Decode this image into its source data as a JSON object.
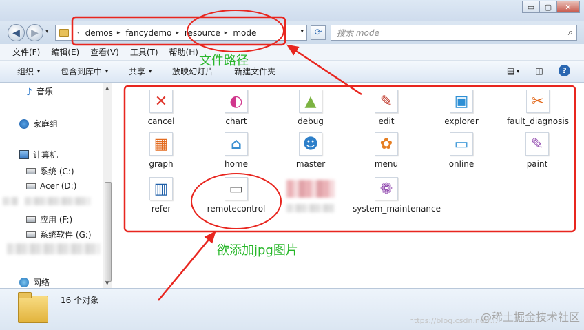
{
  "window": {
    "controls": {
      "minimize": "▭",
      "maximize": "▢",
      "close": "✕"
    }
  },
  "nav": {
    "back_icon": "◀",
    "forward_icon": "▶",
    "history_icon": "▾",
    "breadcrumbs": [
      "demos",
      "fancydemo",
      "resource",
      "mode"
    ],
    "lead_sep": "‹",
    "sep": "▸",
    "dropdown_icon": "▾",
    "refresh_icon": "⟳",
    "search_placeholder": "搜索 mode",
    "search_icon": "⌕"
  },
  "menubar": {
    "items": [
      "文件(F)",
      "编辑(E)",
      "查看(V)",
      "工具(T)",
      "帮助(H)"
    ]
  },
  "commands": {
    "items": [
      {
        "label": "组织",
        "arrow": "▾"
      },
      {
        "label": "包含到库中",
        "arrow": "▾"
      },
      {
        "label": "共享",
        "arrow": "▾"
      },
      {
        "label": "放映幻灯片",
        "arrow": ""
      },
      {
        "label": "新建文件夹",
        "arrow": ""
      }
    ],
    "view_icon": "▤",
    "view_arrow": "▾",
    "preview_icon": "◫",
    "help_icon": "?"
  },
  "navpane": {
    "music": "音乐",
    "music_icon": "♪",
    "homegroup": "家庭组",
    "computer": "计算机",
    "drive_c": "系统 (C:)",
    "drive_d": "Acer (D:)",
    "drive_f": "应用 (F:)",
    "drive_g": "系统软件 (G:)",
    "network": "网络",
    "scroll_up": "▲",
    "scroll_down": "▼"
  },
  "files": [
    {
      "name": "cancel",
      "glyph": "✕",
      "color": "#e0362c"
    },
    {
      "name": "chart",
      "glyph": "◐",
      "color": "#d0368c"
    },
    {
      "name": "debug",
      "glyph": "▲",
      "color": "#7cb342"
    },
    {
      "name": "edit",
      "glyph": "✎",
      "color": "#c0392b"
    },
    {
      "name": "explorer",
      "glyph": "▣",
      "color": "#2d8fd5"
    },
    {
      "name": "fault_diagnosis",
      "glyph": "✂",
      "color": "#e36b1f"
    },
    {
      "name": "graph",
      "glyph": "▦",
      "color": "#e36b1f"
    },
    {
      "name": "home",
      "glyph": "⌂",
      "color": "#3b8fd1"
    },
    {
      "name": "master",
      "glyph": "☻",
      "color": "#2d7fc9"
    },
    {
      "name": "menu",
      "glyph": "✿",
      "color": "#e67e22"
    },
    {
      "name": "online",
      "glyph": "▭",
      "color": "#2d8fd5"
    },
    {
      "name": "paint",
      "glyph": "✎",
      "color": "#9b59b6"
    },
    {
      "name": "refer",
      "glyph": "▥",
      "color": "#1f5fa8"
    },
    {
      "name": "remotecontrol",
      "glyph": "▭",
      "color": "#444444"
    },
    {
      "name": "system_maintenance",
      "glyph": "❁",
      "color": "#8e44ad"
    }
  ],
  "details": {
    "count": "16 个对象"
  },
  "annotations": {
    "path_label": "文件路径",
    "add_label": "欲添加jpg图片",
    "color": "#e8261f"
  },
  "watermark": "@稀土掘金技术社区",
  "watermark_url": "https://blog.csdn.net/..."
}
